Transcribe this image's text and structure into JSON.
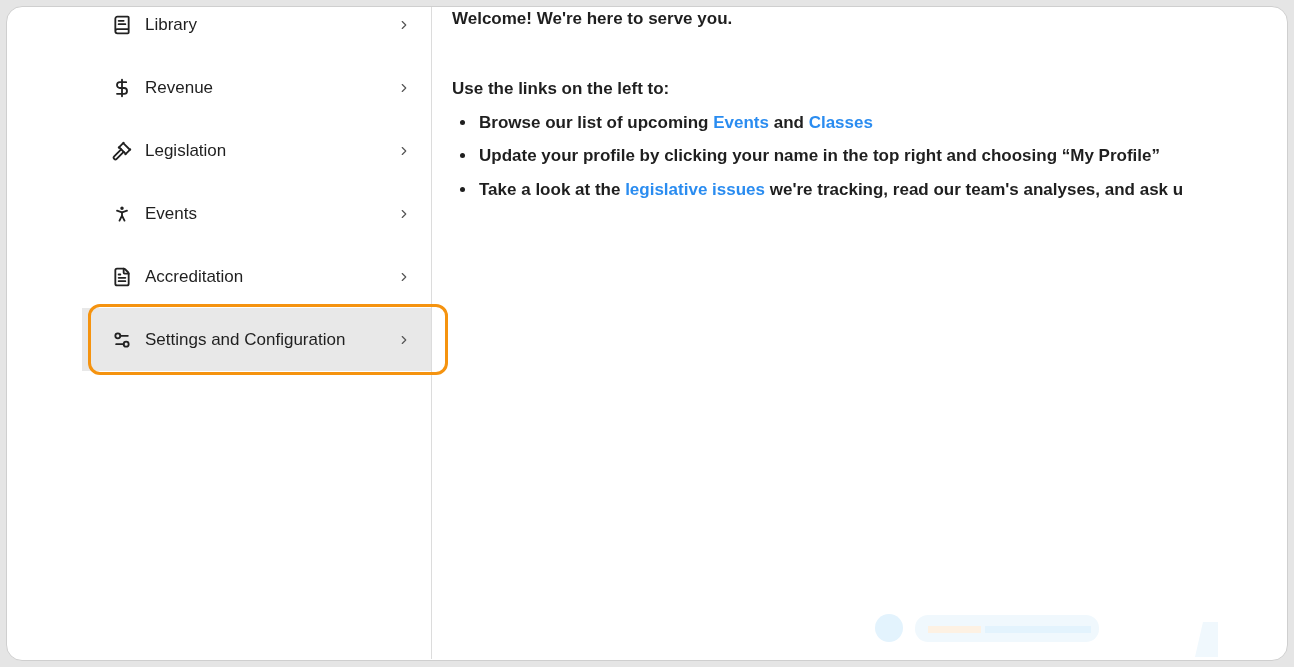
{
  "sidebar": {
    "items": [
      {
        "label": "Library",
        "selected": false
      },
      {
        "label": "Revenue",
        "selected": false
      },
      {
        "label": "Legislation",
        "selected": false
      },
      {
        "label": "Events",
        "selected": false
      },
      {
        "label": "Accreditation",
        "selected": false
      },
      {
        "label": "Settings and Configuration",
        "selected": true
      }
    ]
  },
  "content": {
    "welcome": "Welcome!  We're here to serve you.",
    "intro": "Use the links on the left to:",
    "bullets": [
      [
        {
          "kind": "text",
          "text": "Browse our list of upcoming "
        },
        {
          "kind": "link",
          "text": "Events"
        },
        {
          "kind": "text",
          "text": " and "
        },
        {
          "kind": "link",
          "text": "Classes"
        }
      ],
      [
        {
          "kind": "text",
          "text": "Update your profile by clicking your name in the top right and choosing “My Profile”"
        }
      ],
      [
        {
          "kind": "text",
          "text": "Take a look at the "
        },
        {
          "kind": "link",
          "text": "legislative issues"
        },
        {
          "kind": "text",
          "text": " we're tracking, read our team's analyses, and ask u"
        }
      ]
    ]
  }
}
